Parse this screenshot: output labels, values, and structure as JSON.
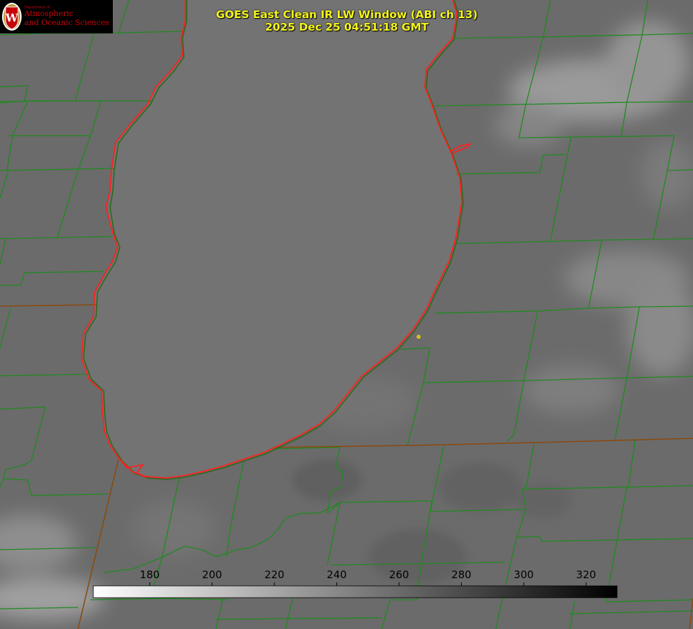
{
  "title": {
    "line1": "GOES East Clean IR LW Window (ABI ch 13)",
    "line2": "2025 Dec 25 04:51:18 GMT"
  },
  "logo": {
    "seal_letter": "W",
    "department": "Department of",
    "line1": "Atmospheric",
    "line2": "and Oceanic Sciences"
  },
  "colorbar": {
    "ticks": [
      "180",
      "200",
      "220",
      "240",
      "260",
      "280",
      "300",
      "320"
    ],
    "min_color": "#ffffff",
    "max_color": "#000000"
  },
  "colors": {
    "county_lines": "#1f8a1f",
    "state_lines": "#8b4a10",
    "lake_shore": "#ff2020",
    "station_marker": "#d8c020",
    "title_text": "#f4f41a",
    "logo_red": "#c5050c"
  }
}
